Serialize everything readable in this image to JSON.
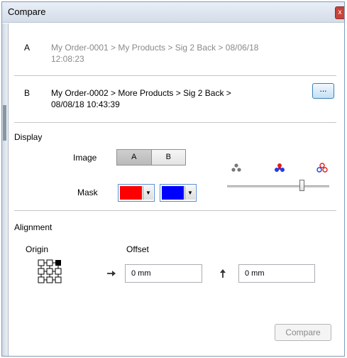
{
  "window": {
    "title": "Compare",
    "close_glyph": "x"
  },
  "source_a": {
    "key": "A",
    "path": "My Order-0001 > My Products > Sig 2 Back > 08/06/18",
    "time": "12:08:23"
  },
  "source_b": {
    "key": "B",
    "path": "My Order-0002 > More Products > Sig 2 Back >",
    "time": "08/08/18 10:43:39",
    "browse_label": "..."
  },
  "display": {
    "heading": "Display",
    "image_label": "Image",
    "image_options": [
      "A",
      "B"
    ],
    "image_selected": "A",
    "mask_label": "Mask",
    "mask_a_color": "#ff0000",
    "mask_b_color": "#0000ff",
    "blend_icons": [
      "gray-dots-icon",
      "red-blue-dots-icon",
      "red-blue-rings-icon"
    ],
    "blend_level": 0.73
  },
  "alignment": {
    "heading": "Alignment",
    "origin_label": "Origin",
    "offset_label": "Offset",
    "offset_x": "0 mm",
    "offset_y": "0 mm"
  },
  "footer": {
    "compare_label": "Compare"
  }
}
